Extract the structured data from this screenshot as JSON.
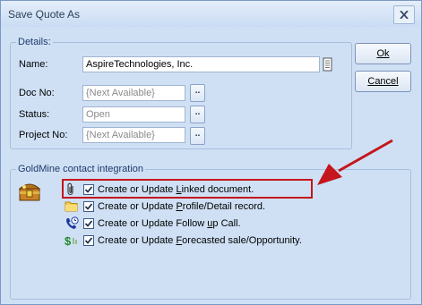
{
  "window": {
    "title": "Save Quote As"
  },
  "details": {
    "legend": "Details:",
    "name_label": "Name:",
    "name_value": "AspireTechnologies, Inc.",
    "docno_label": "Doc No:",
    "docno_value": "{Next Available}",
    "status_label": "Status:",
    "status_value": "Open",
    "projectno_label": "Project No:",
    "projectno_value": "{Next Available}",
    "browse_label": ".."
  },
  "buttons": {
    "ok_label": "Ok",
    "cancel_label": "Cancel"
  },
  "integration": {
    "legend": "GoldMine contact integration",
    "options": [
      {
        "pre": "Create or Update ",
        "accel": "L",
        "post": "inked document.",
        "checked": true,
        "icon": "paperclip-icon"
      },
      {
        "pre": "Create or Update ",
        "accel": "P",
        "post": "rofile/Detail record.",
        "checked": true,
        "icon": "folder-icon"
      },
      {
        "pre": "Create or Update Follow ",
        "accel": "u",
        "post": "p Call.",
        "checked": true,
        "icon": "phone-clock-icon"
      },
      {
        "pre": "Create or Update ",
        "accel": "F",
        "post": "orecasted sale/Opportunity.",
        "checked": true,
        "icon": "dollar-icon"
      }
    ]
  },
  "colors": {
    "window_bg": "#cfe0f5",
    "highlight": "#c4161c",
    "arrow": "#c4161c"
  }
}
